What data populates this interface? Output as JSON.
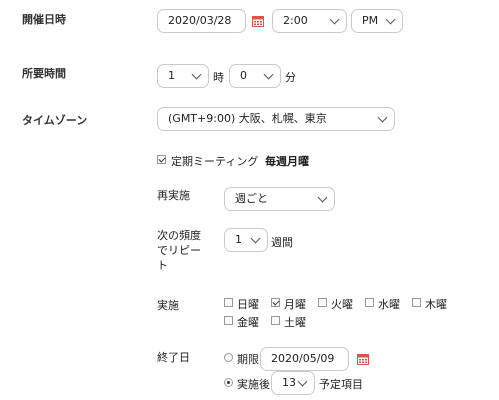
{
  "schedule": {
    "date_label": "開催日時",
    "date_value": "2020/03/28",
    "time_value": "2:00",
    "ampm_value": "PM"
  },
  "duration": {
    "label": "所要時間",
    "hours_value": "1",
    "hours_unit": "時",
    "minutes_value": "0",
    "minutes_unit": "分"
  },
  "timezone": {
    "label": "タイムゾーン",
    "value": "(GMT+9:00) 大阪、札幌、東京"
  },
  "recurring": {
    "checkbox_label": "定期ミーティング",
    "summary": "毎週月曜",
    "repeat_label": "再実施",
    "repeat_value": "週ごと",
    "interval_label": "次の頻度でリピート",
    "interval_label_line1": "次の頻度",
    "interval_label_line2": "でリピー",
    "interval_label_line3": "ト",
    "interval_value": "1",
    "interval_unit": "週間",
    "days_label": "実施",
    "days": [
      {
        "label": "日曜",
        "checked": false
      },
      {
        "label": "月曜",
        "checked": true
      },
      {
        "label": "火曜",
        "checked": false
      },
      {
        "label": "水曜",
        "checked": false
      },
      {
        "label": "木曜",
        "checked": false
      },
      {
        "label": "金曜",
        "checked": false
      },
      {
        "label": "土曜",
        "checked": false
      }
    ],
    "end_label": "終了日",
    "end_by_label": "期限",
    "end_by_date": "2020/05/09",
    "end_after_label": "実施後",
    "end_after_count": "13",
    "end_after_unit": "予定項目"
  },
  "colors": {
    "calendar_icon": "#d9534f",
    "border": "#c9c9cf"
  }
}
